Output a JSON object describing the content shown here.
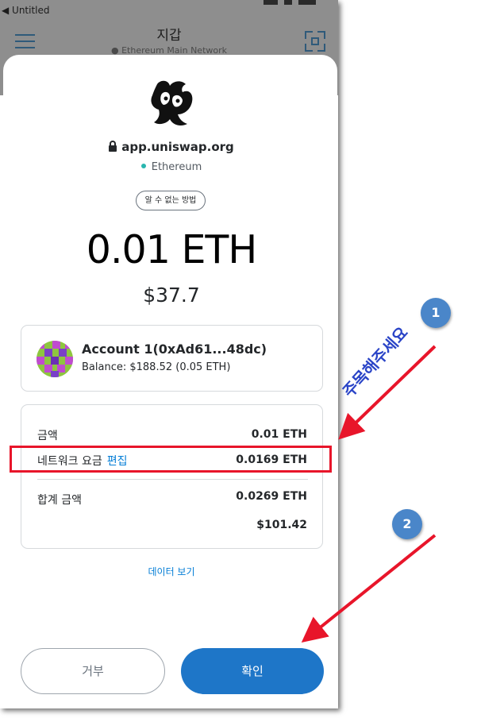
{
  "status_bar": {
    "back_label": "◀ Untitled"
  },
  "app": {
    "title": "지갑",
    "network": "● Ethereum Main Network"
  },
  "sheet": {
    "site": "app.uniswap.org",
    "network": "Ethereum",
    "unknown_method": "알 수 없는 방법",
    "amount": "0.01 ETH",
    "fiat": "$37.7",
    "account": {
      "name": "Account 1(0xAd61...48dc)",
      "balance": "Balance: $188.52 (0.05 ETH)"
    },
    "summary": {
      "amount_label": "금액",
      "amount_value": "0.01 ETH",
      "fee_label": "네트워크 요금",
      "fee_edit": "편집",
      "fee_value": "0.0169 ETH",
      "total_label": "합계 금액",
      "total_value": "0.0269 ETH",
      "total_fiat": "$101.42"
    },
    "view_data": "데이터 보기",
    "reject_label": "거부",
    "confirm_label": "확인"
  },
  "annotations": {
    "badge1": "1",
    "badge2": "2",
    "note": "주목해주세요"
  },
  "colors": {
    "accent": "#037dd6",
    "confirm": "#1e76c8",
    "highlight": "#e8152a",
    "badge": "#4a86c9"
  }
}
